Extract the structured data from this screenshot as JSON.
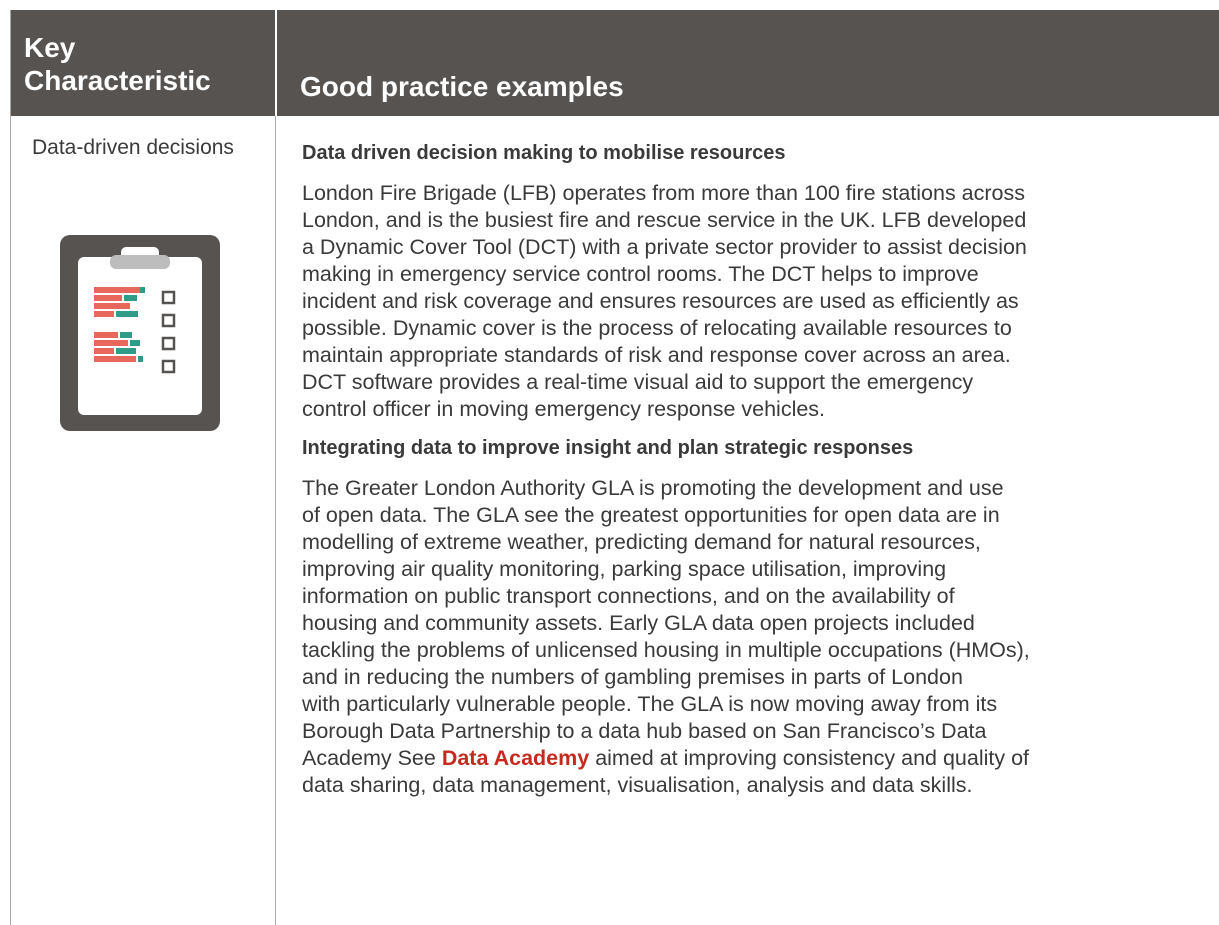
{
  "header": {
    "key_characteristic": "Key Characteristic",
    "good_practice": "Good practice examples"
  },
  "row": {
    "characteristic": "Data-driven decisions",
    "icon": "clipboard-checklist-icon",
    "section1": {
      "title": "Data driven decision making to mobilise resources",
      "lines": [
        "London Fire Brigade (LFB) operates from more than 100 fire stations across",
        "London, and is the busiest fire and rescue service in the UK. LFB developed",
        "a Dynamic Cover Tool (DCT) with a private sector provider to assist decision",
        "making in emergency service control rooms. The DCT helps to improve",
        "incident and risk coverage and ensures resources are used as efficiently as",
        "possible. Dynamic cover is the process of relocating available resources to",
        "maintain appropriate standards of risk and response cover across an area.",
        "DCT software provides a real-time visual aid to support the emergency",
        "control officer in moving emergency response vehicles."
      ]
    },
    "section2": {
      "title": "Integrating data to improve insight and plan strategic responses",
      "lines": [
        "The Greater London Authority GLA is promoting the development and use",
        "of open data. The GLA see the greatest opportunities for open data are in",
        "modelling of extreme weather, predicting demand for natural resources,",
        "improving air quality monitoring, parking space utilisation, improving",
        "information on public transport connections, and on the availability of",
        "housing and community assets. Early GLA data open projects included",
        "tackling the problems of unlicensed housing in multiple occupations (HMOs),",
        "and in reducing the numbers of gambling premises in parts of London",
        "with particularly vulnerable people. The GLA is now moving away from its",
        "Borough Data Partnership to a data hub based on San Francisco’s Data"
      ],
      "link_line_before": "Academy See ",
      "link_text": "Data Academy",
      "link_line_after": " aimed at improving consistency and quality of",
      "last_line": "data sharing, data management, visualisation, analysis and data skills."
    }
  },
  "colors": {
    "header_bg": "#575350",
    "link": "#c62a1f",
    "bar_red": "#e8675d",
    "bar_teal": "#2e9c87"
  }
}
